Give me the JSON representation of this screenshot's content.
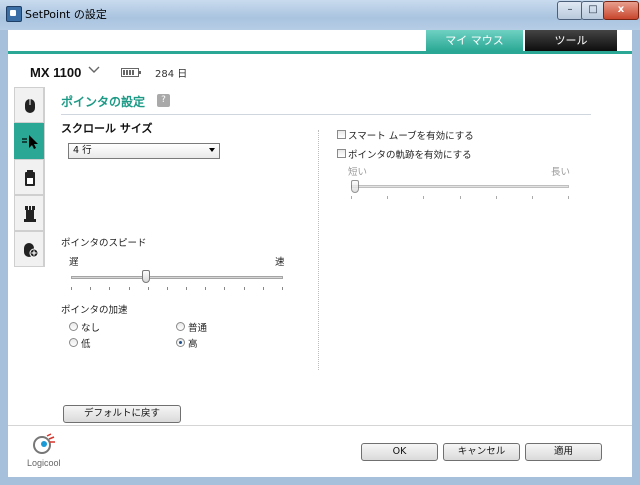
{
  "window": {
    "title": "SetPoint の設定",
    "minimize_label": "–",
    "maximize_label": "□",
    "close_label": "x"
  },
  "tabs": [
    {
      "label": "マイ マウス",
      "active": true
    },
    {
      "label": "ツール",
      "active": false
    }
  ],
  "device": {
    "name": "MX 1100",
    "battery_days": "284 日"
  },
  "side_tabs": [
    {
      "icon": "mouse-buttons-icon"
    },
    {
      "icon": "pointer-icon",
      "active": true
    },
    {
      "icon": "battery-icon"
    },
    {
      "icon": "game-icon"
    },
    {
      "icon": "add-device-icon"
    }
  ],
  "page": {
    "heading": "ポインタの設定",
    "help": "?"
  },
  "scroll": {
    "title": "スクロール サイズ",
    "value": "4 行"
  },
  "speed": {
    "title": "ポインタのスピード",
    "min_label": "遅",
    "max_label": "速",
    "position": 0.35
  },
  "acceleration": {
    "title": "ポインタの加速",
    "options": [
      {
        "label": "なし",
        "selected": false
      },
      {
        "label": "普通",
        "selected": false
      },
      {
        "label": "低",
        "selected": false
      },
      {
        "label": "高",
        "selected": true
      }
    ]
  },
  "smart_move": {
    "label": "スマート ムーブを有効にする",
    "checked": false
  },
  "trails": {
    "label": "ポインタの軌跡を有効にする",
    "checked": false,
    "min_label": "短い",
    "max_label": "長い",
    "position": 0.0
  },
  "buttons": {
    "default": "デフォルトに戻す",
    "ok": "OK",
    "cancel": "キャンセル",
    "apply": "適用"
  },
  "logo": {
    "text": "Logicool"
  },
  "colors": {
    "accent": "#2aa895",
    "heading": "#1c9a86"
  }
}
